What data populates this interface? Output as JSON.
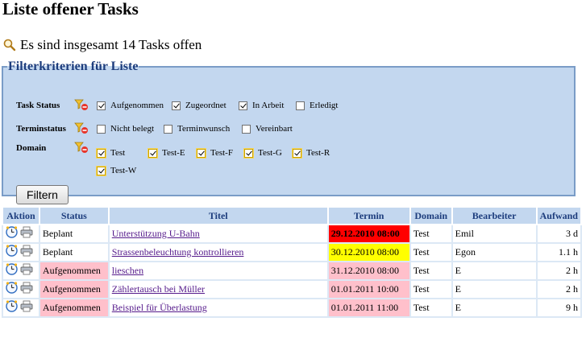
{
  "page": {
    "title": "Liste offener Tasks",
    "summary": "Es sind insgesamt 14 Tasks offen"
  },
  "filter": {
    "legend": "Filterkriterien für Liste",
    "task_status_label": "Task Status",
    "task_status": [
      {
        "label": "Aufgenommen",
        "checked": true
      },
      {
        "label": "Zugeordnet",
        "checked": true
      },
      {
        "label": "In Arbeit",
        "checked": true
      },
      {
        "label": "Erledigt",
        "checked": false
      }
    ],
    "terminstatus_label": "Terminstatus",
    "terminstatus": [
      {
        "label": "Nicht belegt",
        "checked": false
      },
      {
        "label": "Terminwunsch",
        "checked": false
      },
      {
        "label": "Vereinbart",
        "checked": false
      }
    ],
    "domain_label": "Domain",
    "domain": [
      {
        "label": "Test",
        "checked": true
      },
      {
        "label": "Test-E",
        "checked": true
      },
      {
        "label": "Test-F",
        "checked": true
      },
      {
        "label": "Test-G",
        "checked": true
      },
      {
        "label": "Test-R",
        "checked": true
      },
      {
        "label": "Test-W",
        "checked": true
      }
    ],
    "submit_label": "Filtern"
  },
  "table": {
    "headers": [
      "Aktion",
      "Status",
      "Titel",
      "Termin",
      "Domain",
      "Bearbeiter",
      "Aufwand"
    ],
    "rows": [
      {
        "status": "Beplant",
        "titel": "Unterstützung U-Bahn",
        "termin": "29.12.2010 08:00",
        "termin_color": "#ff0000",
        "domain": "Test",
        "bearbeiter": "Emil",
        "aufwand": "3 d"
      },
      {
        "status": "Beplant",
        "titel": "Strassenbeleuchtung kontrollieren",
        "termin": "30.12.2010 08:00",
        "termin_color": "#ffff00",
        "domain": "Test",
        "bearbeiter": "Egon",
        "aufwand": "1.1 h"
      },
      {
        "status": "Aufgenommen",
        "titel": "lieschen",
        "termin": "31.12.2010 08:00",
        "termin_color": "#ffc0cb",
        "domain": "Test",
        "bearbeiter": "E",
        "aufwand": "2 h"
      },
      {
        "status": "Aufgenommen",
        "titel": "Zählertausch bei Müller",
        "termin": "01.01.2011 10:00",
        "termin_color": "#ffc0cb",
        "domain": "Test",
        "bearbeiter": "E",
        "aufwand": "2 h"
      },
      {
        "status": "Aufgenommen",
        "titel": "Beispiel für Überlastung",
        "termin": "01.01.2011 11:00",
        "termin_color": "#ffc0cb",
        "domain": "Test",
        "bearbeiter": "E",
        "aufwand": "9 h"
      }
    ]
  },
  "colors": {
    "filter_bg": "#c3d7ef",
    "legend_text": "#1d3d7d",
    "status_aufgenommen": "#ffc0cb",
    "overdue": "#ff0000",
    "due_soon": "#ffff00"
  },
  "icons": [
    "magnifier-icon",
    "clear-filter-icon",
    "clock-icon",
    "printer-icon"
  ]
}
